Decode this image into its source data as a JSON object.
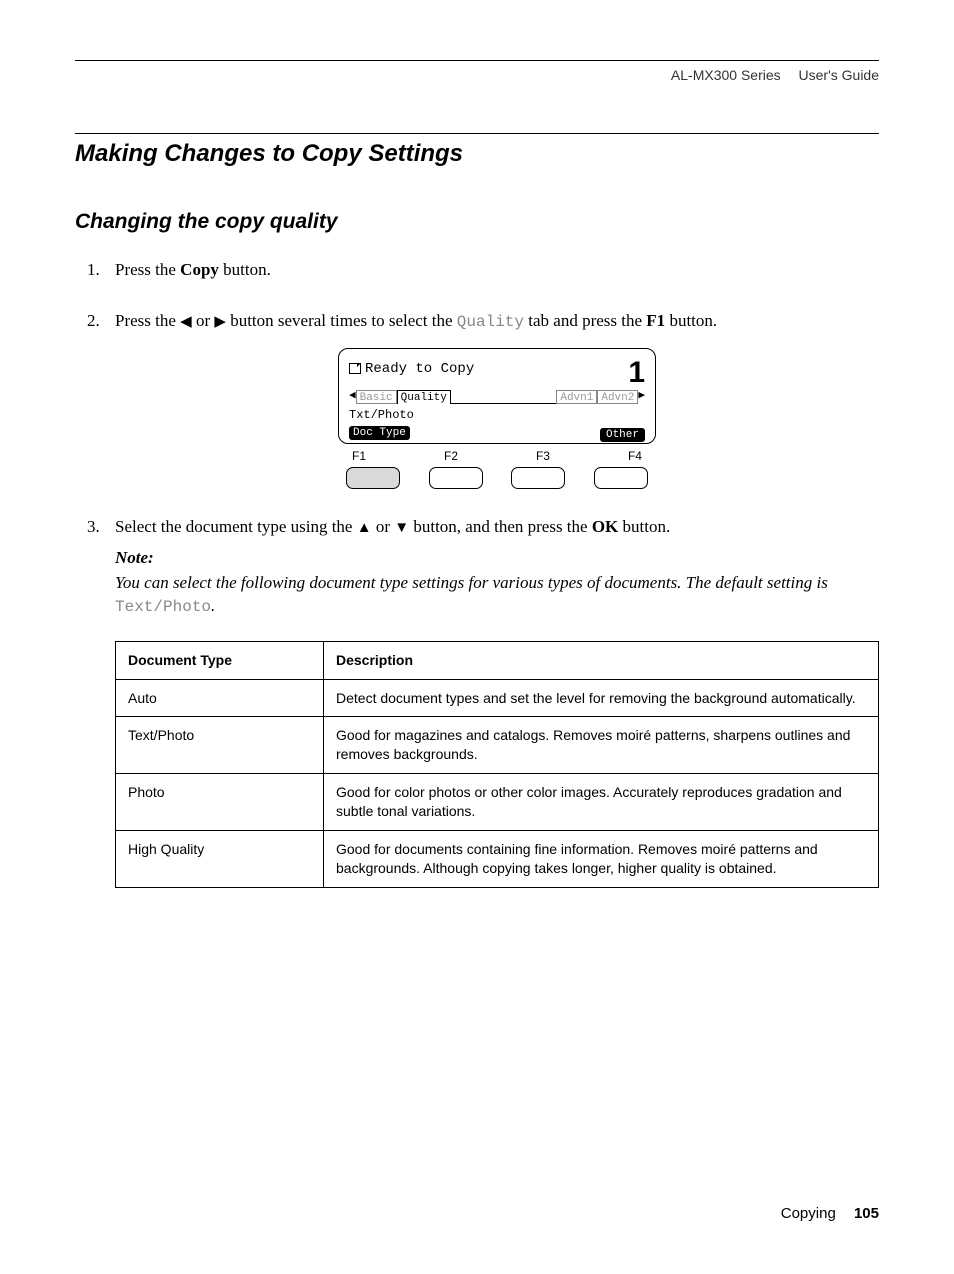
{
  "header": {
    "series": "AL-MX300 Series",
    "doc": "User's Guide"
  },
  "section_title": "Making Changes to Copy Settings",
  "subsection_title": "Changing the copy quality",
  "steps": {
    "s1": {
      "num": "1.",
      "pre": "Press the ",
      "btn": "Copy",
      "post": " button."
    },
    "s2": {
      "num": "2.",
      "pre": "Press the ",
      "left_arrow": "◀",
      "mid1": " or ",
      "right_arrow": "▶",
      "mid2": " button several times to select the ",
      "tab_label": "Quality",
      "mid3": " tab and press the ",
      "btn": "F1",
      "post": " button."
    },
    "s3": {
      "num": "3.",
      "pre": "Select the document type using the ",
      "up_arrow": "▲",
      "mid1": " or ",
      "down_arrow": "▼",
      "mid2": " button, and then press the ",
      "btn": "OK",
      "post": " button."
    }
  },
  "lcd": {
    "ready": "Ready to Copy",
    "copies": "1",
    "tabs": {
      "basic": "Basic",
      "quality": "Quality",
      "advn1": "Advn1",
      "advn2": "Advn2"
    },
    "txtphoto": "Txt/Photo",
    "doctype": "Doc Type",
    "other": "Other",
    "fkeys": {
      "f1": "F1",
      "f2": "F2",
      "f3": "F3",
      "f4": "F4"
    }
  },
  "note": {
    "label": "Note:",
    "body_pre": "You can select the following document type settings for various types of documents. The default setting is ",
    "default_val": "Text/Photo",
    "body_post": "."
  },
  "table": {
    "headers": {
      "type": "Document Type",
      "desc": "Description"
    },
    "rows": [
      {
        "type": "Auto",
        "desc": "Detect document types and set the level for removing the background automatically."
      },
      {
        "type": "Text/Photo",
        "desc": "Good for magazines and catalogs. Removes moiré patterns, sharpens outlines and removes backgrounds."
      },
      {
        "type": "Photo",
        "desc": "Good for color photos or other color images. Accurately reproduces gradation and subtle tonal variations."
      },
      {
        "type": "High Quality",
        "desc": "Good for documents containing fine information. Removes moiré patterns and backgrounds. Although copying takes longer, higher quality is obtained."
      }
    ]
  },
  "footer": {
    "chapter": "Copying",
    "page": "105"
  }
}
